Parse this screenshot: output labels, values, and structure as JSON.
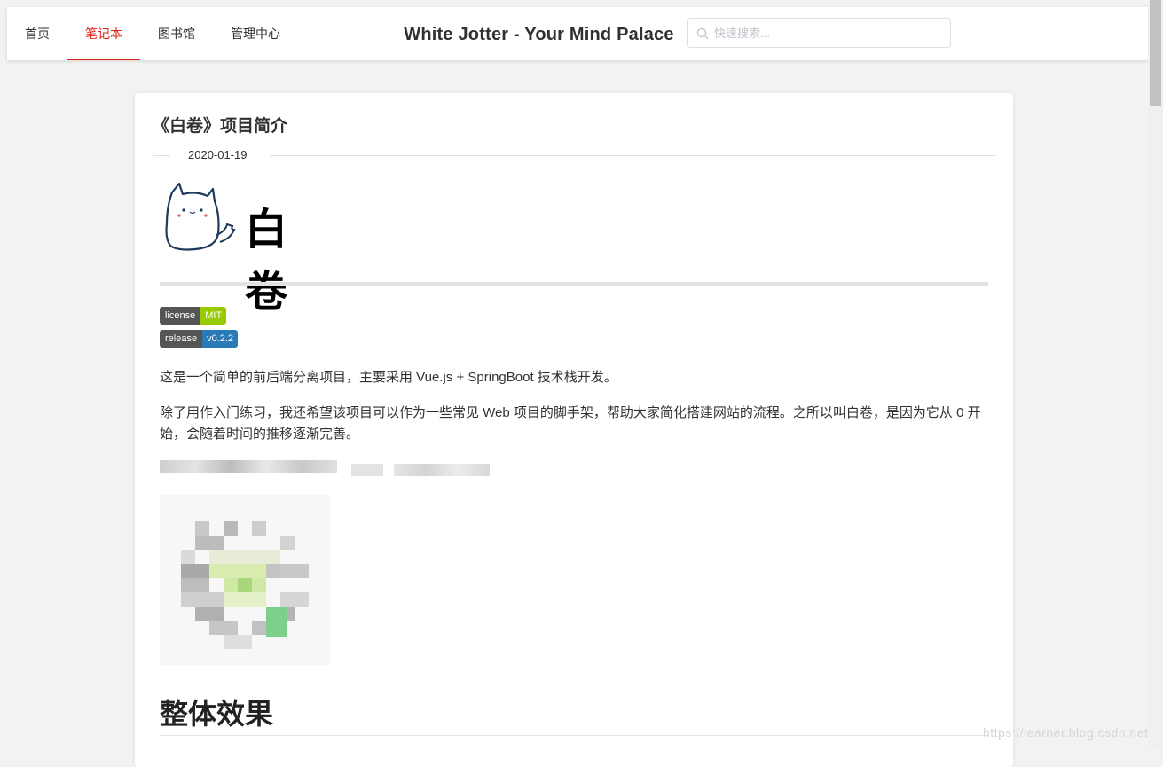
{
  "nav": {
    "items": [
      "首页",
      "笔记本",
      "图书馆",
      "管理中心"
    ],
    "active_index": 1,
    "brand": "White Jotter - Your Mind Palace",
    "search_placeholder": "快速搜索..."
  },
  "article": {
    "title": "《白卷》项目简介",
    "date": "2020-01-19",
    "logo_text": "白卷",
    "badges": [
      {
        "label": "license",
        "value": "MIT",
        "color": "#97ca00"
      },
      {
        "label": "release",
        "value": "v0.2.2",
        "color": "#2a7ab8"
      }
    ],
    "paragraphs": [
      "这是一个简单的前后端分离项目，主要采用 Vue.js + SpringBoot 技术栈开发。",
      "除了用作入门练习，我还希望该项目可以作为一些常见 Web 项目的脚手架，帮助大家简化搭建网站的流程。之所以叫白卷，是因为它从 0 开始，会随着时间的推移逐渐完善。"
    ],
    "section_heading": "整体效果"
  },
  "watermark": "https://learner.blog.csdn.net",
  "colors": {
    "accent": "#e1251b",
    "page_bg": "#f2f2f2"
  }
}
